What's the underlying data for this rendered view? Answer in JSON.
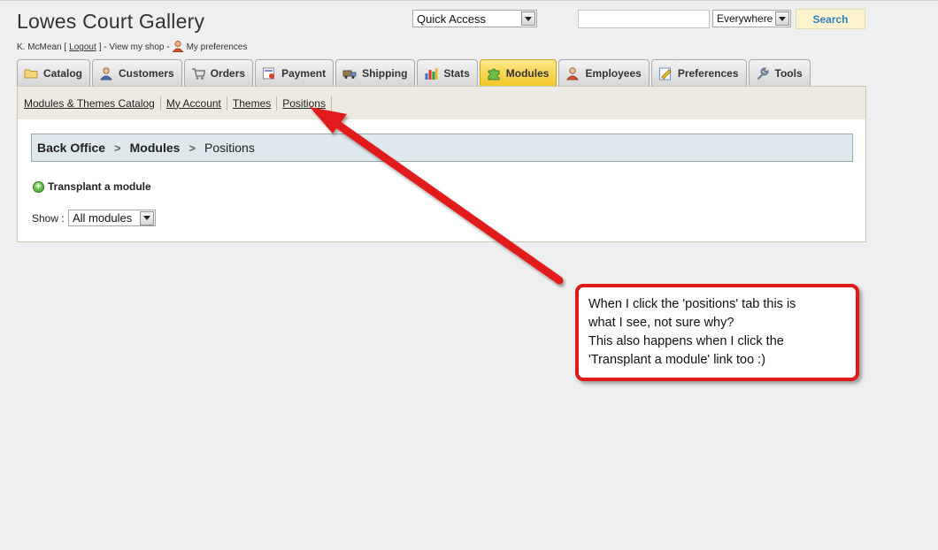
{
  "header": {
    "shop_title": "Lowes Court Gallery",
    "user_name": "K. McMean [",
    "logout": "Logout",
    "after_logout": "] - View my shop -",
    "preferences": "My preferences",
    "quick_access": "Quick Access",
    "search_scope": "Everywhere",
    "search_button": "Search",
    "search_value": ""
  },
  "tabs": [
    {
      "label": "Catalog",
      "icon": "folder-icon"
    },
    {
      "label": "Customers",
      "icon": "customer-icon"
    },
    {
      "label": "Orders",
      "icon": "cart-icon"
    },
    {
      "label": "Payment",
      "icon": "payment-icon"
    },
    {
      "label": "Shipping",
      "icon": "truck-icon"
    },
    {
      "label": "Stats",
      "icon": "bar-chart-icon"
    },
    {
      "label": "Modules",
      "icon": "puzzle-icon",
      "active": true
    },
    {
      "label": "Employees",
      "icon": "employee-icon"
    },
    {
      "label": "Preferences",
      "icon": "preferences-icon"
    },
    {
      "label": "Tools",
      "icon": "wrench-icon"
    }
  ],
  "subnav": [
    "Modules & Themes Catalog",
    "My Account",
    "Themes",
    "Positions"
  ],
  "breadcrumb": {
    "home": "Back Office",
    "section": "Modules",
    "current": "Positions"
  },
  "transplant_label": "Transplant a module",
  "show": {
    "label": "Show :",
    "value": "All modules"
  },
  "annotation": {
    "lines": [
      "When I click the 'positions' tab this is",
      "what I see, not sure why?",
      "This also happens when I click the",
      "'Transplant a module' link too :)"
    ],
    "color": "#e01919"
  },
  "colors": {
    "active_tab": "#f2c626",
    "search_text": "#2f7fc0",
    "breadcrumb_bg": "#dfe8ec"
  }
}
